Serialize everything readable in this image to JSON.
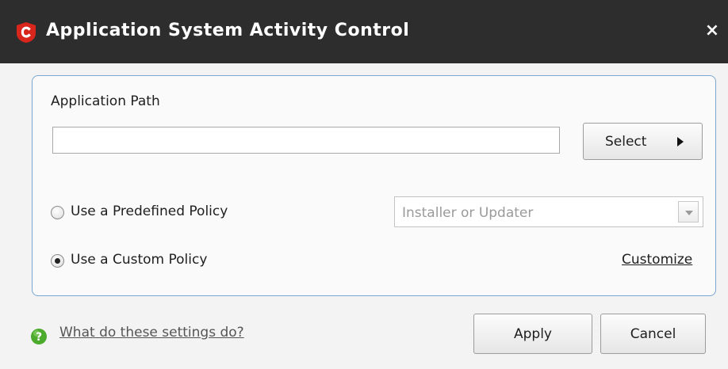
{
  "window": {
    "title": "Application System Activity Control",
    "close_glyph": "×",
    "logo_icon": "comodo-shield-icon",
    "titlebar_color": "#2d2d2d",
    "logo_color": "#d9261c"
  },
  "path": {
    "label": "Application Path",
    "value": "",
    "placeholder": "",
    "select_label": "Select"
  },
  "policy": {
    "predefined": {
      "label": "Use a Predefined Policy",
      "checked": false,
      "dropdown_value": "Installer or Updater",
      "dropdown_enabled": false
    },
    "custom": {
      "label": "Use a Custom Policy",
      "checked": true,
      "customize_label": "Customize"
    }
  },
  "footer": {
    "help_label": "What do these settings do?",
    "help_icon": "question-help-icon",
    "apply_label": "Apply",
    "cancel_label": "Cancel"
  },
  "colors": {
    "panel_border": "#7aa6cf",
    "help_icon": "#4caa2c"
  }
}
